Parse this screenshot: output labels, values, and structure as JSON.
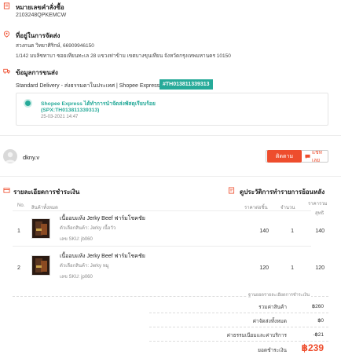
{
  "order_number": {
    "title": "หมายเลขคำสั่งซื้อ",
    "value": "2103248QPKEMCW"
  },
  "address": {
    "title": "ที่อยู่ในการจัดส่ง",
    "name_phone": "สวงกนต วิทยาศิริกษ์, 66909946150",
    "line": "1/142 มบลิซทาบา ซอยเทียนทะเล 28 แขวงท่าข้าม เขตบางขุนเทียน จังหวัดกรุงเทพมหานคร 10150"
  },
  "shipping": {
    "title": "ข้อมูลการขนส่ง",
    "method": "Standard Delivery - ส่งธรรมดาในประเทศ | Shopee Express",
    "tracking_badge": "#TH013811339313",
    "event_title": "Shopee Express ได้ทำการนำจัดส่งพัสดุเรียบร้อย",
    "event_sub": "(SPX:TH013811339313)",
    "event_time": "25-03-2021 14:47"
  },
  "seller": {
    "name": "dkny.v",
    "primary_btn": "ติดตาม",
    "secondary_btn": "แชทเลย"
  },
  "payment": {
    "title": "รายละเอียดการชำระเงิน",
    "history_link": "ดูประวัติการทำรายการย้อนหลัง",
    "headers": {
      "no": "No.",
      "product": "สินค้าทั้งหมด",
      "unit_price": "ราคาต่อชิ้น",
      "qty": "จำนวน",
      "subtotal_a": "ราคารวม",
      "subtotal_b": "สุทธิ"
    },
    "items": [
      {
        "no": "1",
        "name": "เนื้ออบแห้ง Jerky Beef ฟาร์มโชคชัย",
        "variant": "ตัวเลือกสินค้า: Jerky เนื้อวัว",
        "sku": "เลข SKU: jb060",
        "price": "140",
        "qty": "1",
        "total": "140"
      },
      {
        "no": "2",
        "name": "เนื้ออบแห้ง Jerky Beef ฟาร์มโชคชัย",
        "variant": "ตัวเลือกสินค้า: Jerky หมู",
        "sku": "เลข SKU: jp060",
        "price": "120",
        "qty": "1",
        "total": "120"
      }
    ],
    "summary_header": "ฐานยอดรายละเอียดการชำระเงิน",
    "summary": [
      {
        "label": "รวมค่าสินค้า",
        "value": "฿260"
      },
      {
        "label": "ค่าจัดส่งทั้งหมด",
        "value": "฿0"
      },
      {
        "label": "ค่าธรรมเนียมและค่าบริการ",
        "value": "-฿21"
      }
    ],
    "grand_total_label": "ยอดชำระเงิน",
    "grand_total_value": "฿239"
  },
  "colors": {
    "brand": "#ee4d2d",
    "teal": "#26aa99"
  }
}
